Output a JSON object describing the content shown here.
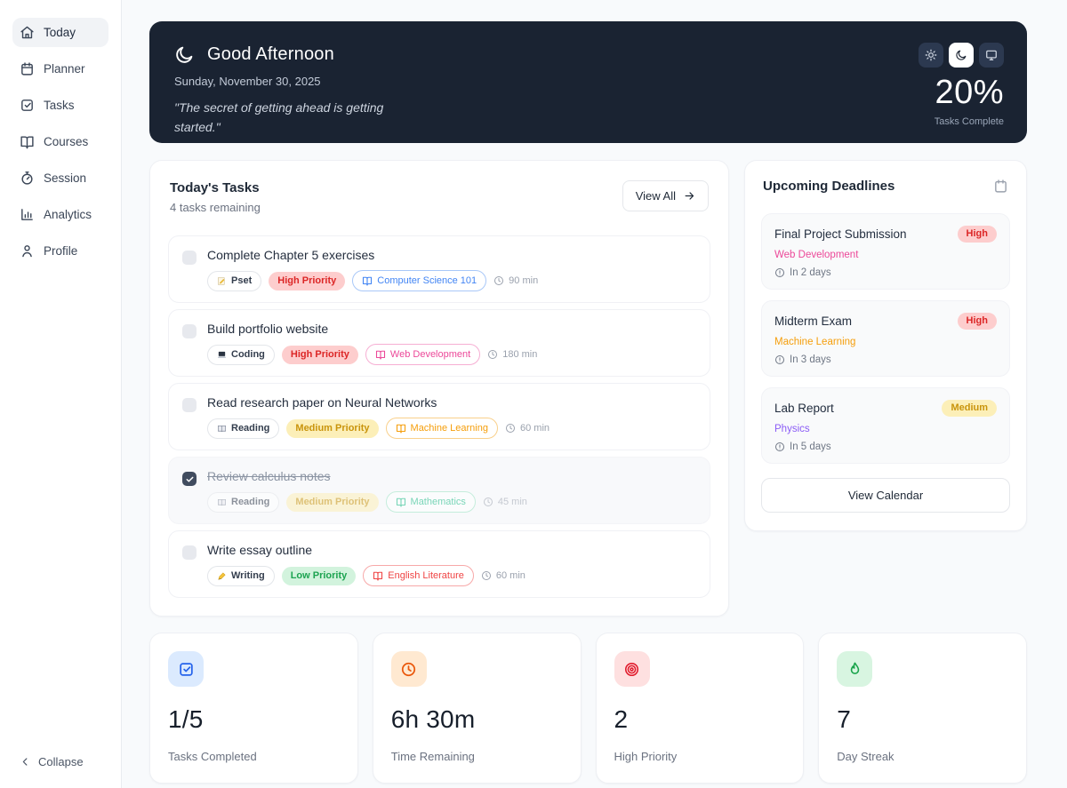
{
  "sidebar": {
    "items": [
      {
        "label": "Today",
        "icon": "home",
        "active": true
      },
      {
        "label": "Planner",
        "icon": "calendar",
        "active": false
      },
      {
        "label": "Tasks",
        "icon": "check-square",
        "active": false
      },
      {
        "label": "Courses",
        "icon": "book-open",
        "active": false
      },
      {
        "label": "Session",
        "icon": "timer",
        "active": false
      },
      {
        "label": "Analytics",
        "icon": "bar-chart",
        "active": false
      },
      {
        "label": "Profile",
        "icon": "user",
        "active": false
      }
    ],
    "collapse_label": "Collapse"
  },
  "header": {
    "greeting": "Good Afternoon",
    "date": "Sunday, November 30, 2025",
    "quote": "\"The secret of getting ahead is getting started.\"",
    "progress_percent": "20%",
    "progress_label": "Tasks Complete",
    "theme_active": "dark",
    "card_color": "#1a2332"
  },
  "tasks_section": {
    "title": "Today's Tasks",
    "subtitle": "4 tasks remaining",
    "view_all_label": "View All",
    "tasks": [
      {
        "title": "Complete Chapter 5 exercises",
        "completed": false,
        "type_icon": "memo-icon",
        "type_label": "Pset",
        "priority_label": "High Priority",
        "priority_level": "high",
        "course_label": "Computer Science 101",
        "course_color": "#4285f4",
        "duration": "90 min"
      },
      {
        "title": "Build portfolio website",
        "completed": false,
        "type_icon": "laptop-icon",
        "type_label": "Coding",
        "priority_label": "High Priority",
        "priority_level": "high",
        "course_label": "Web Development",
        "course_color": "#ec4899",
        "duration": "180 min"
      },
      {
        "title": "Read research paper on Neural Networks",
        "completed": false,
        "type_icon": "book-icon",
        "type_label": "Reading",
        "priority_label": "Medium Priority",
        "priority_level": "medium",
        "course_label": "Machine Learning",
        "course_color": "#f59e0b",
        "duration": "60 min"
      },
      {
        "title": "Review calculus notes",
        "completed": true,
        "type_icon": "book-icon",
        "type_label": "Reading",
        "priority_label": "Medium Priority",
        "priority_level": "medium",
        "course_label": "Mathematics",
        "course_color": "#10b981",
        "duration": "45 min"
      },
      {
        "title": "Write essay outline",
        "completed": false,
        "type_icon": "pen-icon",
        "type_label": "Writing",
        "priority_label": "Low Priority",
        "priority_level": "low",
        "course_label": "English Literature",
        "course_color": "#ef4444",
        "duration": "60 min"
      }
    ]
  },
  "deadlines_section": {
    "title": "Upcoming Deadlines",
    "items": [
      {
        "title": "Final Project Submission",
        "badge": "High",
        "level": "high",
        "course": "Web Development",
        "course_color": "#ec4899",
        "due": "In 2 days"
      },
      {
        "title": "Midterm Exam",
        "badge": "High",
        "level": "high",
        "course": "Machine Learning",
        "course_color": "#f59e0b",
        "due": "In 3 days"
      },
      {
        "title": "Lab Report",
        "badge": "Medium",
        "level": "medium",
        "course": "Physics",
        "course_color": "#8b5cf6",
        "due": "In 5 days"
      }
    ],
    "view_calendar_label": "View Calendar"
  },
  "stats": [
    {
      "icon": "check-square-icon",
      "value": "1/5",
      "label": "Tasks Completed",
      "fg": "#2563eb",
      "bg": "#dbeafe"
    },
    {
      "icon": "clock-icon",
      "value": "6h 30m",
      "label": "Time Remaining",
      "fg": "#ea580c",
      "bg": "#ffe9d1"
    },
    {
      "icon": "target-icon",
      "value": "2",
      "label": "High Priority",
      "fg": "#e11d2e",
      "bg": "#fee0e0"
    },
    {
      "icon": "flame-icon",
      "value": "7",
      "label": "Day Streak",
      "fg": "#18a34a",
      "bg": "#d8f5e1"
    }
  ],
  "colors": {
    "priority_high_bg": "#fdcdcd",
    "priority_high_text": "#dc2626",
    "priority_medium_bg": "#fcefb8",
    "priority_medium_text": "#c9940c",
    "priority_low_bg": "#d2f3dd",
    "priority_low_text": "#1ca350",
    "page_bg": "#f8fafc"
  }
}
